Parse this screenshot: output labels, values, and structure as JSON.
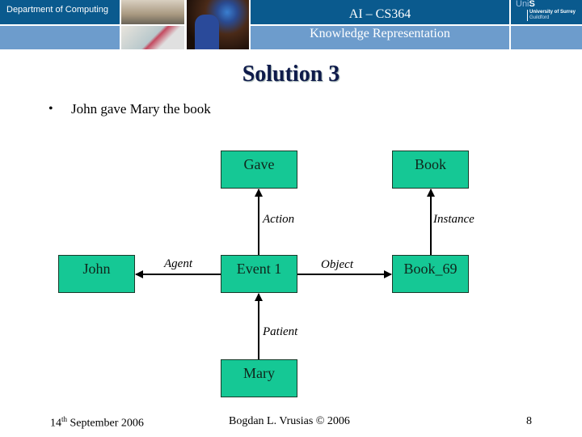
{
  "header": {
    "department": "Department of Computing",
    "course": "AI – CS364",
    "subject": "Knowledge Representation",
    "logo": {
      "uni": "Uni",
      "s": "S",
      "name": "University of Surrey",
      "location": "Guildford"
    },
    "colors": {
      "dark_band": "#0a5a8e",
      "light_band": "#6d9ccc"
    }
  },
  "slide": {
    "title": "Solution 3",
    "bullet_glyph": "•",
    "bullet_text": "John gave Mary the book"
  },
  "diagram": {
    "node_color": "#15c895",
    "nodes": {
      "gave": "Gave",
      "book": "Book",
      "john": "John",
      "event": "Event 1",
      "book69": "Book_69",
      "mary": "Mary"
    },
    "edges": {
      "action": {
        "label": "Action",
        "from": "Event 1",
        "to": "Gave"
      },
      "instance": {
        "label": "Instance",
        "from": "Book_69",
        "to": "Book"
      },
      "agent": {
        "label": "Agent",
        "from": "Event 1",
        "to": "John"
      },
      "object": {
        "label": "Object",
        "from": "Event 1",
        "to": "Book_69"
      },
      "patient": {
        "label": "Patient",
        "from": "Mary",
        "to": "Event 1"
      }
    }
  },
  "footer": {
    "date_day": "14",
    "date_sup": "th",
    "date_rest": " September 2006",
    "author": "Bogdan L. Vrusias © 2006",
    "page": "8"
  }
}
